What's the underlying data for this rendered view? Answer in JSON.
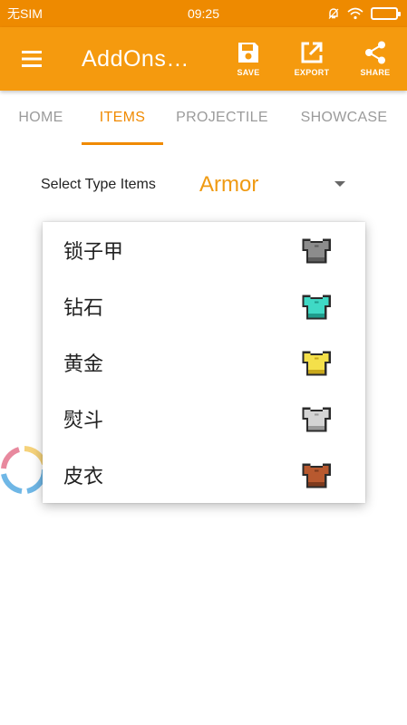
{
  "status_bar": {
    "carrier": "无SIM",
    "time": "09:25"
  },
  "app_bar": {
    "title": "AddOns…",
    "actions": [
      {
        "label": "SAVE",
        "icon": "save-icon"
      },
      {
        "label": "EXPORT",
        "icon": "export-icon"
      },
      {
        "label": "SHARE",
        "icon": "share-icon"
      }
    ]
  },
  "tabs": [
    {
      "label": "HOME",
      "active": false
    },
    {
      "label": "ITEMS",
      "active": true
    },
    {
      "label": "PROJECTILE",
      "active": false
    },
    {
      "label": "SHOWCASE",
      "active": false
    }
  ],
  "select": {
    "label": "Select Type Items",
    "value": "Armor"
  },
  "dropdown": {
    "items": [
      {
        "label": "锁子甲",
        "color": "#8c8c8c",
        "shade": "#5e5e5e",
        "icon": "chainmail-chestplate-icon"
      },
      {
        "label": "钻石",
        "color": "#3fd9c5",
        "shade": "#1f9c8c",
        "icon": "diamond-chestplate-icon"
      },
      {
        "label": "黄金",
        "color": "#f4e04a",
        "shade": "#c9a81c",
        "icon": "gold-chestplate-icon"
      },
      {
        "label": "熨斗",
        "color": "#d4d4d4",
        "shade": "#9a9a9a",
        "icon": "iron-chestplate-icon"
      },
      {
        "label": "皮衣",
        "color": "#b8592f",
        "shade": "#7d3a1d",
        "icon": "leather-chestplate-icon"
      }
    ]
  },
  "colors": {
    "status_bar": "#ee8a00",
    "app_bar": "#f59a0e",
    "accent": "#f08a00"
  }
}
